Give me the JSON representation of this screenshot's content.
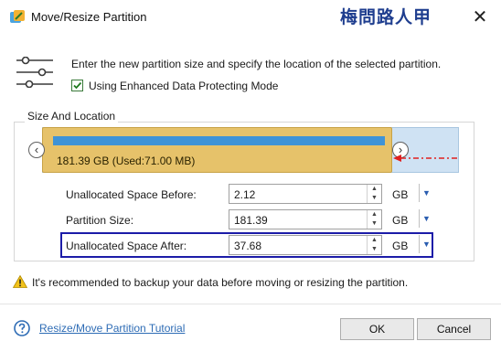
{
  "window": {
    "title": "Move/Resize Partition",
    "watermark": "梅問路人甲",
    "close_glyph": "✕"
  },
  "header": {
    "intro": "Enter the new partition size and specify the location of the selected partition.",
    "enhanced_mode_label": "Using Enhanced Data Protecting Mode",
    "enhanced_mode_checked": true
  },
  "size_and_location": {
    "title": "Size And Location",
    "partition_label": "181.39 GB (Used:71.00 MB)",
    "left_handle_glyph": "‹",
    "right_handle_glyph": "›",
    "rows": [
      {
        "label": "Unallocated Space Before:",
        "value": "2.12",
        "unit": "GB"
      },
      {
        "label": "Partition Size:",
        "value": "181.39",
        "unit": "GB"
      },
      {
        "label": "Unallocated Space After:",
        "value": "37.68",
        "unit": "GB"
      }
    ]
  },
  "warning": "It's recommended to backup your data before moving or resizing the partition.",
  "footer": {
    "help_link": "Resize/Move Partition Tutorial",
    "ok_label": "OK",
    "cancel_label": "Cancel"
  },
  "colors": {
    "partition": "#e6c26a",
    "usage_bar": "#3f93d6",
    "unallocated": "#cfe2f3",
    "highlight": "#1c1ca8",
    "arrow": "#e02020",
    "link": "#2e6cb5"
  }
}
